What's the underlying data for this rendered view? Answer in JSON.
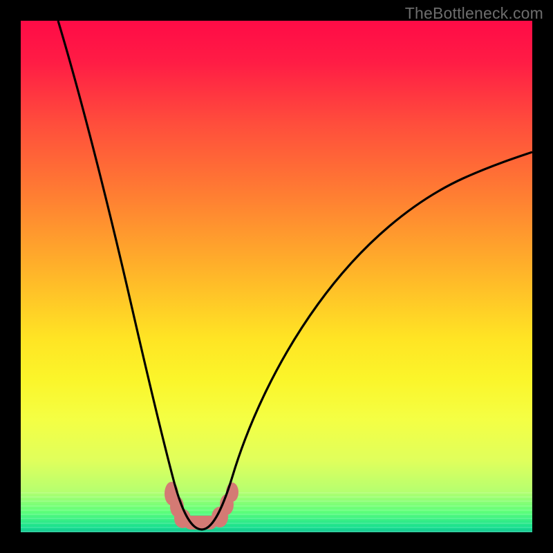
{
  "watermark": "TheBottleneck.com",
  "chart_data": {
    "type": "line",
    "title": "",
    "xlabel": "",
    "ylabel": "",
    "xlim": [
      0,
      100
    ],
    "ylim": [
      0,
      100
    ],
    "grid": false,
    "legend": false,
    "description": "Bottleneck percentage curve over a red-to-green heat gradient. The curve descends from upper-left to a minimum near x≈34%, then rises toward the right edge at roughly 60% height.",
    "series": [
      {
        "name": "bottleneck-curve",
        "curve_approx": [
          {
            "x": 7,
            "y": 100
          },
          {
            "x": 12,
            "y": 85
          },
          {
            "x": 17,
            "y": 68
          },
          {
            "x": 22,
            "y": 48
          },
          {
            "x": 26,
            "y": 30
          },
          {
            "x": 29,
            "y": 16
          },
          {
            "x": 31,
            "y": 7
          },
          {
            "x": 33,
            "y": 2
          },
          {
            "x": 35,
            "y": 0.5
          },
          {
            "x": 37,
            "y": 2
          },
          {
            "x": 39,
            "y": 7
          },
          {
            "x": 43,
            "y": 18
          },
          {
            "x": 50,
            "y": 32
          },
          {
            "x": 60,
            "y": 45
          },
          {
            "x": 72,
            "y": 54
          },
          {
            "x": 85,
            "y": 60
          },
          {
            "x": 100,
            "y": 64
          }
        ]
      }
    ],
    "trough_markers": {
      "color": "#d47a74",
      "points_y_percent_leq": 7,
      "rendered_as": "salmon rounded blobs along the valley"
    },
    "background_gradient": {
      "top": "#ff0b46",
      "mid": "#ffe424",
      "bottom": "#12c491"
    }
  }
}
